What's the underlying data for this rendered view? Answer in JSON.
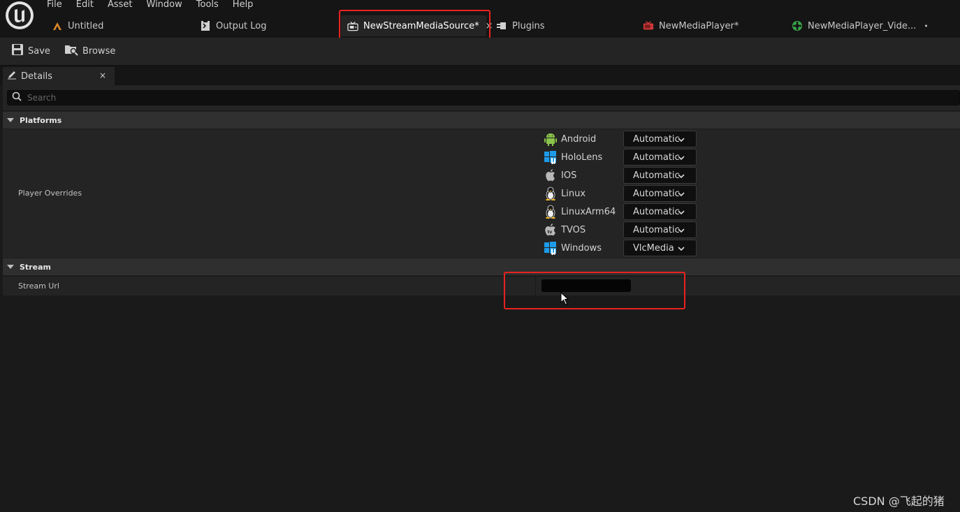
{
  "menu": [
    "File",
    "Edit",
    "Asset",
    "Window",
    "Tools",
    "Help"
  ],
  "doc_tabs": [
    {
      "label": "Untitled",
      "icon": "level-icon",
      "icon_color": "#e08a2a",
      "suffix": ""
    },
    {
      "label": "Output Log",
      "icon": "output-log-icon",
      "icon_color": "#d0d0d0",
      "suffix": ""
    },
    {
      "label": "NewStreamMediaSource*",
      "icon": "media-source-icon",
      "icon_color": "#d0d0d0",
      "close": "×"
    },
    {
      "label": "Plugins",
      "icon": "plugin-icon",
      "icon_color": "#d0d0d0",
      "suffix": ""
    },
    {
      "label": "NewMediaPlayer*",
      "icon": "media-player-icon",
      "icon_color": "#e03a3a",
      "suffix": ""
    },
    {
      "label": "NewMediaPlayer_Vide...",
      "icon": "media-texture-icon",
      "icon_color": "#3aa84a",
      "suffix": "•"
    }
  ],
  "toolbar": {
    "save_label": "Save",
    "browse_label": "Browse"
  },
  "details": {
    "tab_label": "Details",
    "tab_close": "×",
    "search_placeholder": "Search",
    "categories": {
      "platforms": "Platforms",
      "stream": "Stream"
    },
    "player_overrides_label": "Player Overrides",
    "platforms": [
      {
        "name": "Android",
        "value": "Automatic",
        "icon": "android-icon"
      },
      {
        "name": "HoloLens",
        "value": "Automatic",
        "icon": "windows-icon"
      },
      {
        "name": "IOS",
        "value": "Automatic",
        "icon": "apple-icon"
      },
      {
        "name": "Linux",
        "value": "Automatic",
        "icon": "linux-icon"
      },
      {
        "name": "LinuxArm64",
        "value": "Automatic",
        "icon": "linux-icon"
      },
      {
        "name": "TVOS",
        "value": "Automatic",
        "icon": "tvos-icon"
      },
      {
        "name": "Windows",
        "value": "VlcMedia",
        "icon": "windows-icon"
      }
    ],
    "stream_url_label": "Stream Url",
    "stream_url_value": ""
  },
  "colors": {
    "highlight": "#e8231f",
    "background": "#1a1a1a",
    "panel": "#242424"
  },
  "watermark": "CSDN @飞起的猪"
}
